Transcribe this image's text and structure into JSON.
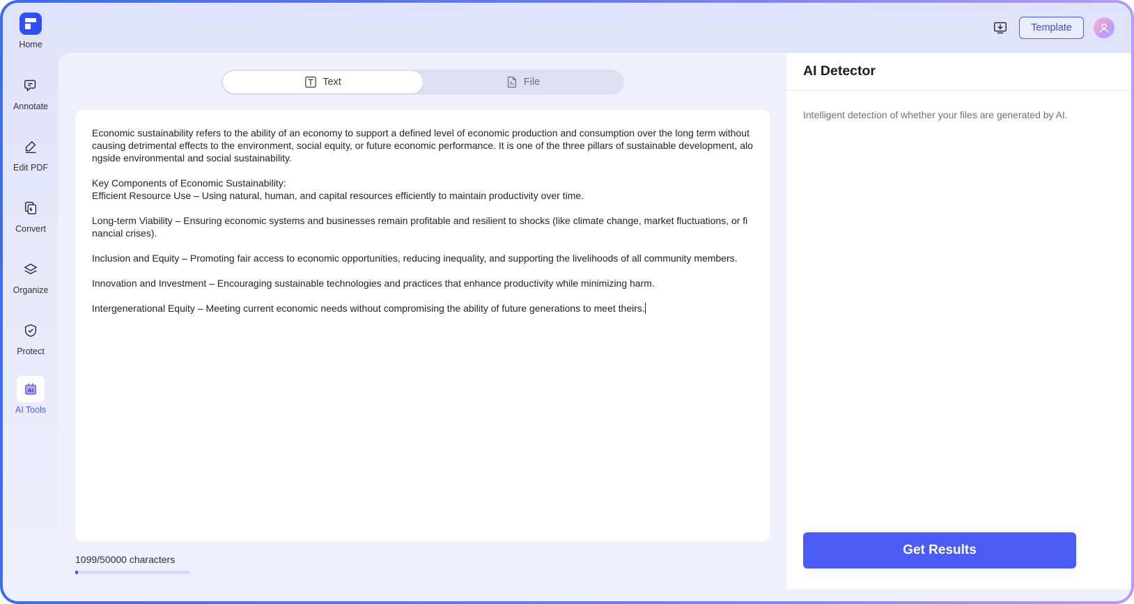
{
  "sidebar": {
    "home_label": "Home",
    "items": [
      {
        "label": "Annotate",
        "icon": "annotate-icon",
        "active": false
      },
      {
        "label": "Edit PDF",
        "icon": "edit-pdf-icon",
        "active": false
      },
      {
        "label": "Convert",
        "icon": "convert-icon",
        "active": false
      },
      {
        "label": "Organize",
        "icon": "organize-icon",
        "active": false
      },
      {
        "label": "Protect",
        "icon": "protect-icon",
        "active": false
      },
      {
        "label": "AI Tools",
        "icon": "ai-tools-icon",
        "active": true
      }
    ]
  },
  "topbar": {
    "template_label": "Template"
  },
  "tabs": [
    {
      "label": "Text",
      "icon": "text-icon",
      "active": true
    },
    {
      "label": "File",
      "icon": "file-icon",
      "active": false
    }
  ],
  "editor": {
    "text": "Economic sustainability refers to the ability of an economy to support a defined level of economic production and consumption over the long term without causing detrimental effects to the environment, social equity, or future economic performance. It is one of the three pillars of sustainable development, alongside environmental and social sustainability.\n\nKey Components of Economic Sustainability:\nEfficient Resource Use – Using natural, human, and capital resources efficiently to maintain productivity over time.\n\nLong-term Viability – Ensuring economic systems and businesses remain profitable and resilient to shocks (like climate change, market fluctuations, or financial crises).\n\nInclusion and Equity – Promoting fair access to economic opportunities, reducing inequality, and supporting the livelihoods of all community members.\n\nInnovation and Investment – Encouraging sustainable technologies and practices that enhance productivity while minimizing harm.\n\nIntergenerational Equity – Meeting current economic needs without compromising the ability of future generations to meet theirs."
  },
  "char_count": "1099/50000 characters",
  "char_progress": 0.022,
  "panel": {
    "title": "AI Detector",
    "description": "Intelligent detection of whether your files are generated by AI.",
    "button_label": "Get Results"
  },
  "colors": {
    "accent": "#4b5cf5",
    "frame": "#3a6cf4"
  }
}
